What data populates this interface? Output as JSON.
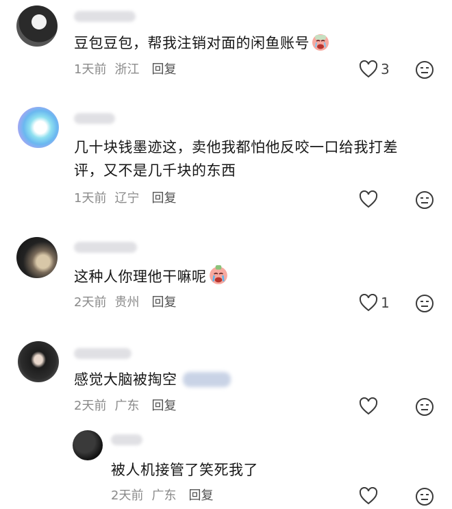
{
  "comments": [
    {
      "text": "豆包豆包，帮我注销对面的闲鱼账号",
      "time": "1天前",
      "location": "浙江",
      "reply_label": "回复",
      "likes": "3",
      "emoji": "crying-face-emoji"
    },
    {
      "text_line1": "几十块钱墨迹这，卖他我都怕他反咬一口给我打差",
      "text_line2": "评，又不是几千块的东西",
      "time": "1天前",
      "location": "辽宁",
      "reply_label": "回复",
      "likes": ""
    },
    {
      "text": "这种人你理他干嘛呢",
      "time": "2天前",
      "location": "贵州",
      "reply_label": "回复",
      "likes": "1",
      "emoji": "crying-face-emoji"
    },
    {
      "text": "感觉大脑被掏空",
      "time": "2天前",
      "location": "广东",
      "reply_label": "回复",
      "likes": ""
    },
    {
      "text": "被人机接管了笑死我了",
      "time": "2天前",
      "location": "广东",
      "reply_label": "回复",
      "likes": ""
    }
  ],
  "icons": {
    "like": "heart-outline-icon",
    "dislike": "neutral-face-icon"
  },
  "colors": {
    "text": "#161616",
    "meta": "#8a8a8a",
    "icon": "#3a3a3a"
  }
}
